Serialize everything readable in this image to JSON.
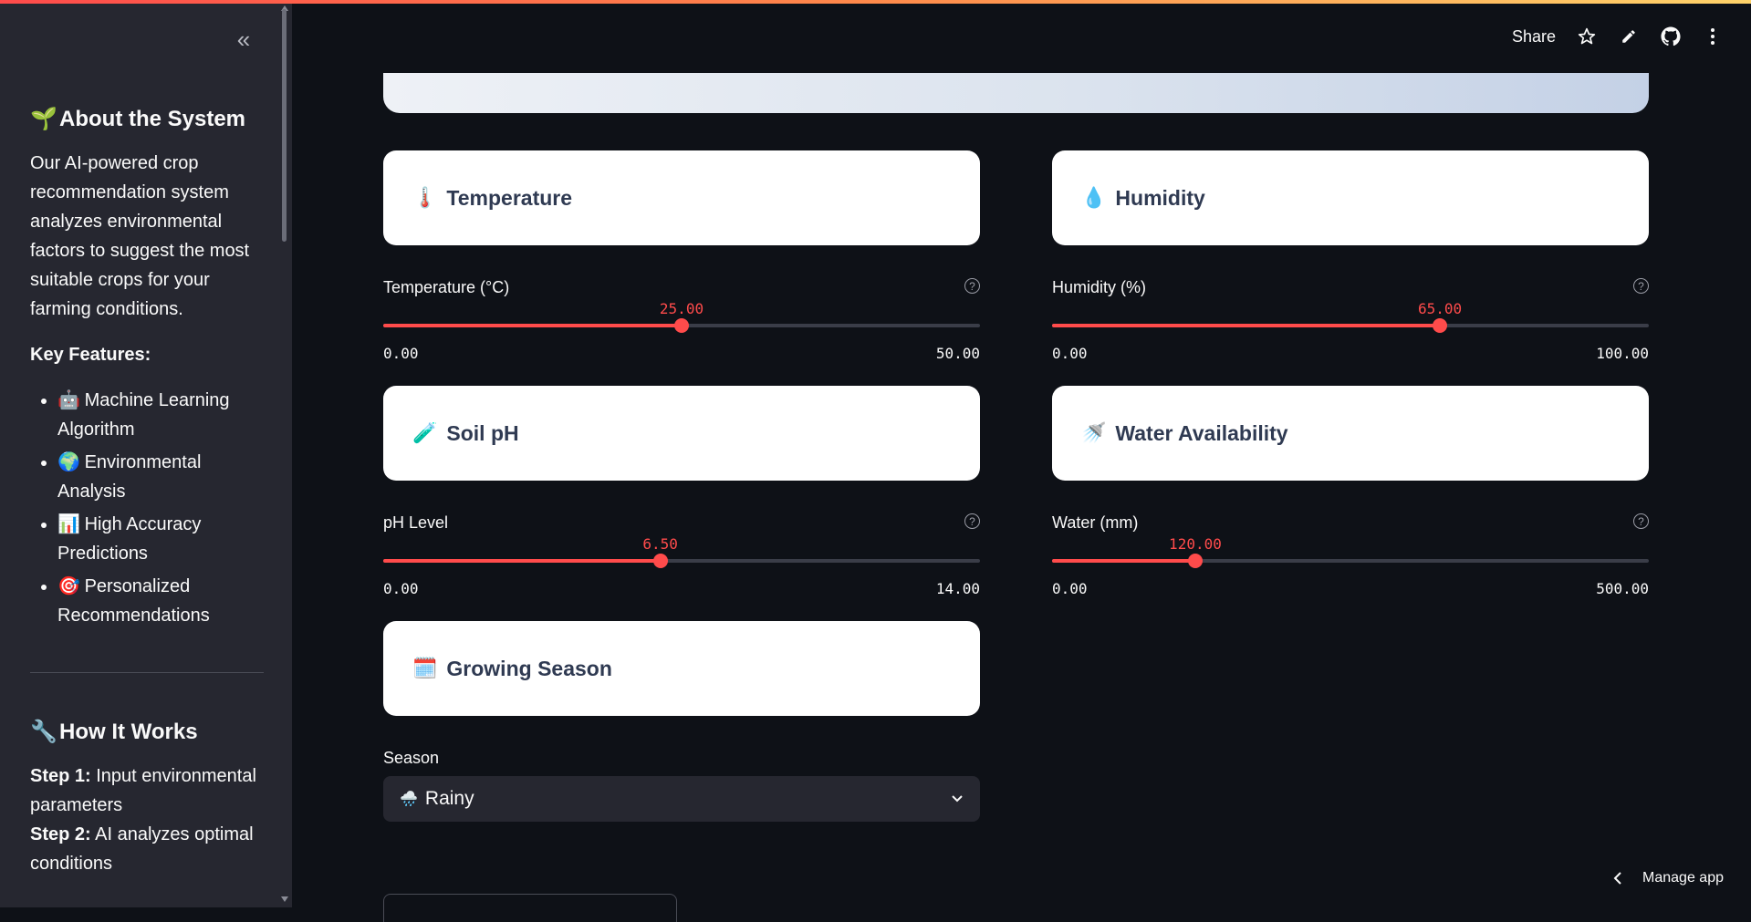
{
  "header": {
    "share_label": "Share",
    "icons": [
      "star-icon",
      "pencil-icon",
      "github-icon",
      "more-vertical-icon"
    ]
  },
  "sidebar": {
    "collapse_icon": "«",
    "about": {
      "emoji": "🌱",
      "title": "About the System",
      "description": "Our AI-powered crop recommendation system analyzes environmental factors to suggest the most suitable crops for your farming conditions."
    },
    "features_heading": "Key Features:",
    "features": [
      {
        "emoji": "🤖",
        "label": "Machine Learning Algorithm"
      },
      {
        "emoji": "🌍",
        "label": "Environmental Analysis"
      },
      {
        "emoji": "📊",
        "label": "High Accuracy Predictions"
      },
      {
        "emoji": "🎯",
        "label": "Personalized Recommendations"
      }
    ],
    "how": {
      "emoji": "🔧",
      "title": "How It Works",
      "steps": [
        {
          "label": "Step 1:",
          "text": "Input environmental parameters"
        },
        {
          "label": "Step 2:",
          "text": "AI analyzes optimal conditions"
        }
      ]
    }
  },
  "cards": {
    "temperature": {
      "emoji": "🌡️",
      "title": "Temperature"
    },
    "humidity": {
      "emoji": "💧",
      "title": "Humidity"
    },
    "soil": {
      "emoji": "🧪",
      "title": "Soil pH"
    },
    "water": {
      "emoji": "🚿",
      "title": "Water Availability"
    },
    "season": {
      "emoji": "🗓️",
      "title": "Growing Season"
    }
  },
  "sliders": {
    "temperature": {
      "label": "Temperature (°C)",
      "value": "25.00",
      "min": "0.00",
      "max": "50.00",
      "fraction": 0.5
    },
    "humidity": {
      "label": "Humidity (%)",
      "value": "65.00",
      "min": "0.00",
      "max": "100.00",
      "fraction": 0.65
    },
    "ph": {
      "label": "pH Level",
      "value": "6.50",
      "min": "0.00",
      "max": "14.00",
      "fraction": 0.4643
    },
    "water": {
      "label": "Water (mm)",
      "value": "120.00",
      "min": "0.00",
      "max": "500.00",
      "fraction": 0.24
    }
  },
  "season_select": {
    "label": "Season",
    "emoji": "🌧️",
    "value": "Rainy"
  },
  "footer": {
    "manage_app": "Manage app"
  },
  "colors": {
    "accent": "#ff4b4b",
    "background": "#0e1117",
    "sidebar": "#262730",
    "card": "#ffffff",
    "card_text": "#2f3a52"
  }
}
